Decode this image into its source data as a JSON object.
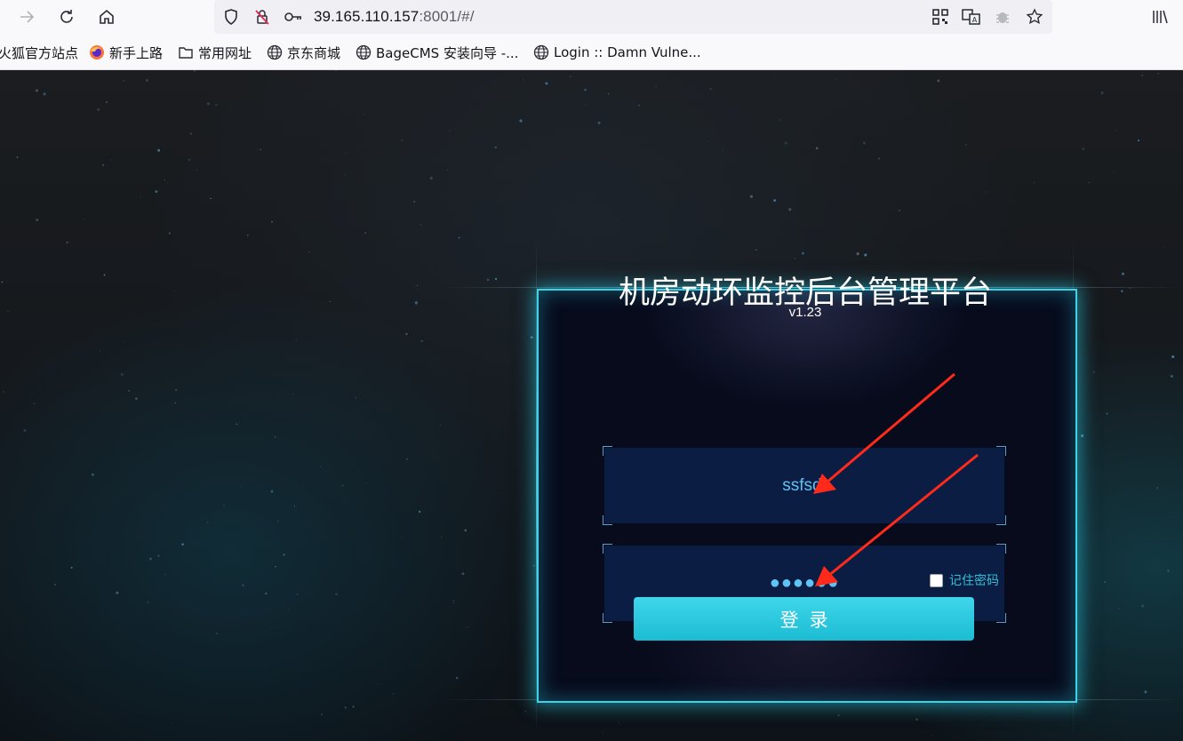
{
  "browser": {
    "url_host": "39.165.110.157",
    "url_rest": ":8001/#/",
    "bookmarks": [
      {
        "label": "火狐官方站点",
        "icon": "none"
      },
      {
        "label": "新手上路",
        "icon": "firefox-logo"
      },
      {
        "label": "常用网址",
        "icon": "folder-icon"
      },
      {
        "label": "京东商城",
        "icon": "globe-icon"
      },
      {
        "label": "BageCMS 安装向导 -...",
        "icon": "globe-icon"
      },
      {
        "label": "Login :: Damn Vulne...",
        "icon": "globe-icon"
      }
    ]
  },
  "login": {
    "title": "机房动环监控后台管理平台",
    "version": "v1.23",
    "username_value": "ssfsdf",
    "password_masked": "●●●●●●",
    "remember_label": "记住密码",
    "remember_checked": false,
    "submit_label": "登录"
  },
  "colors": {
    "accent": "#3fd2e6",
    "input_text": "#5fc3f3",
    "annotation_arrow": "#ff2a1a"
  }
}
